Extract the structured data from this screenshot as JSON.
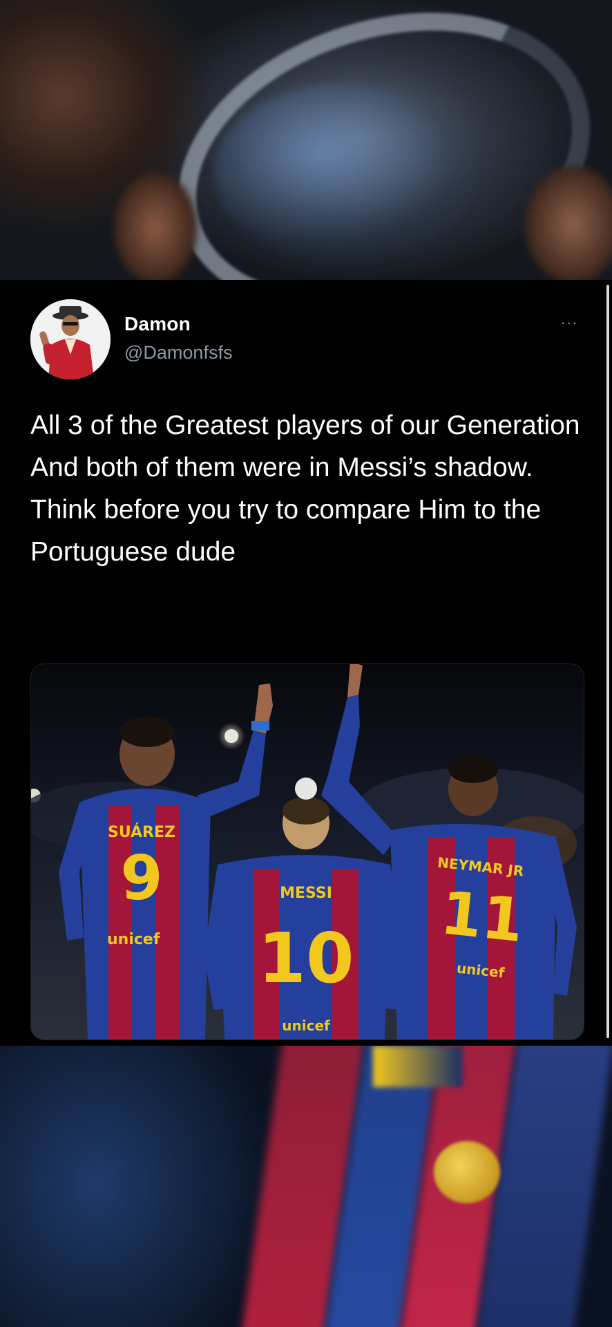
{
  "tweet": {
    "author_name": "Damon",
    "author_handle": "@Damonfsfs",
    "more_label": "···",
    "text": "All 3 of the Greatest players of our Generation And both of them were in Messi’s shadow. Think before you try to compare Him to the Portuguese dude",
    "image": {
      "jerseys": [
        {
          "name": "SUÁREZ",
          "number": "9",
          "sponsor": "unicef"
        },
        {
          "name": "MESSI",
          "number": "10",
          "sponsor": "unicef"
        },
        {
          "name": "NEYMAR JR",
          "number": "11",
          "sponsor": "unicef"
        }
      ]
    }
  },
  "colors": {
    "background": "#000000",
    "text_primary": "#ffffff",
    "text_secondary": "#8b98a5",
    "jersey_blue": "#243f9c",
    "jersey_red": "#a3163a",
    "jersey_yellow": "#f2c81e"
  },
  "icons": {
    "more": "more-horizontal-icon",
    "avatar": "user-avatar"
  }
}
